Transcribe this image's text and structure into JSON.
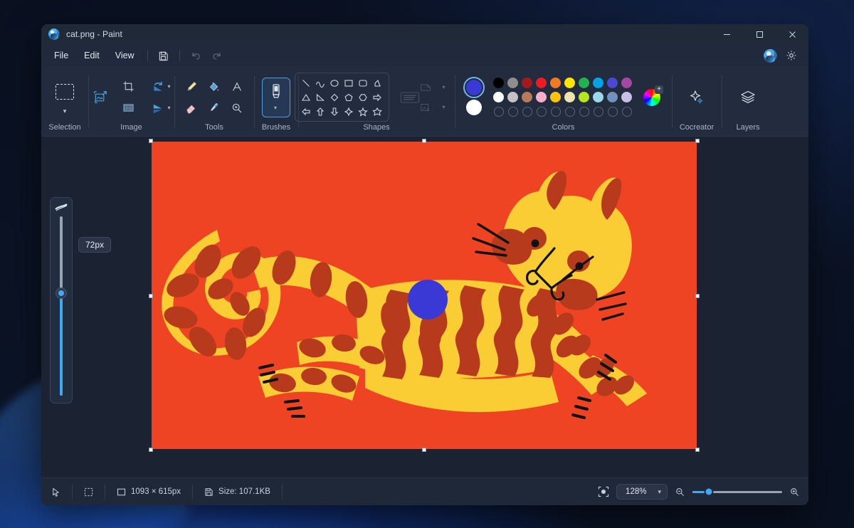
{
  "window": {
    "title": "cat.png - Paint",
    "app_icon": "paint-app-icon",
    "controls": {
      "minimize": "–",
      "maximize": "☐",
      "close": "✕"
    }
  },
  "menubar": {
    "items": [
      {
        "label": "File",
        "name": "menu-file"
      },
      {
        "label": "Edit",
        "name": "menu-edit"
      },
      {
        "label": "View",
        "name": "menu-view"
      }
    ],
    "quick_actions": [
      {
        "name": "save-icon",
        "label": "Save",
        "enabled": true
      },
      {
        "name": "undo-icon",
        "label": "Undo",
        "enabled": false
      },
      {
        "name": "redo-icon",
        "label": "Redo",
        "enabled": false
      }
    ],
    "right": [
      {
        "name": "account-avatar",
        "label": "Account"
      },
      {
        "name": "settings-gear-icon",
        "label": "Settings"
      }
    ]
  },
  "ribbon": {
    "groups": [
      {
        "label": "Selection",
        "name": "group-selection"
      },
      {
        "label": "Image",
        "name": "group-image"
      },
      {
        "label": "Tools",
        "name": "group-tools"
      },
      {
        "label": "Brushes",
        "name": "group-brushes"
      },
      {
        "label": "Shapes",
        "name": "group-shapes"
      },
      {
        "label": "Colors",
        "name": "group-colors"
      },
      {
        "label": "Cocreator",
        "name": "group-cocreator"
      },
      {
        "label": "Layers",
        "name": "group-layers"
      }
    ],
    "image_tools": [
      "crop-icon",
      "rotate-icon",
      "resize-image-icon",
      "transparent-selection-icon",
      "flip-icon"
    ],
    "tools": [
      "pencil-tool",
      "fill-tool",
      "text-tool",
      "eraser-tool",
      "eyedropper-tool",
      "magnifier-tool"
    ],
    "shapes": [
      "line",
      "curve",
      "oval",
      "rectangle",
      "rounded-rectangle",
      "polygon",
      "triangle",
      "right-triangle",
      "diamond",
      "pentagon",
      "hexagon",
      "right-arrow",
      "left-arrow",
      "up-arrow",
      "down-arrow",
      "four-point-star",
      "five-point-star",
      "six-point-star"
    ],
    "shape_options": [
      "outline-style",
      "fill-style",
      "shape-thickness"
    ]
  },
  "colors": {
    "primary": "#3b39d6",
    "secondary": "#ffffff",
    "row1": [
      "#000000",
      "#8e8e8e",
      "#a41a1a",
      "#ed1c24",
      "#f07b23",
      "#ffe500",
      "#22b14c",
      "#00a2e8",
      "#4a49d6",
      "#a349a4"
    ],
    "row2": [
      "#ffffff",
      "#c3c3c3",
      "#b97a57",
      "#ffaec9",
      "#ffc20e",
      "#efe4b0",
      "#b5e61d",
      "#99d9ea",
      "#7092be",
      "#c8bfe7"
    ],
    "row3_empty_count": 10,
    "edit_colors_label": "Edit colors"
  },
  "brush": {
    "size_label": "72px",
    "size_value": 72,
    "slider_icon": "brush-size-icon"
  },
  "canvas": {
    "artwork_name": "cat-drawing",
    "background_color": "#ef4423",
    "body_color": "#fbcd34",
    "stripe_color": "#b83a1d",
    "accent_dot_color": "#3b39d6",
    "line_color": "#111111"
  },
  "statusbar": {
    "cursor_icon": "cursor-arrow-icon",
    "selection_icon": "selection-icon",
    "dimensions_icon": "dimensions-icon",
    "dimensions": "1093 × 615px",
    "size_icon": "file-size-icon",
    "file_size": "Size: 107.1KB",
    "fit_icon": "fit-to-window-icon",
    "zoom_level": "128%",
    "zoom_caret": "⌄",
    "zoom_out_icon": "zoom-out-icon",
    "zoom_in_icon": "zoom-in-icon"
  }
}
